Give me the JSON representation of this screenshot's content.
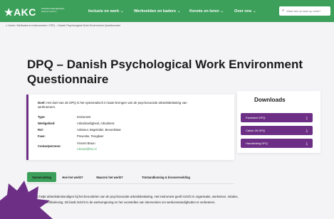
{
  "header": {
    "logo": "AKC",
    "logo_sub": "Arbeidsomstandigheden Kennis Centrum",
    "nav": [
      {
        "label": "Inclusie en werk"
      },
      {
        "label": "Werkvelden en kaders"
      },
      {
        "label": "Kennis en leren"
      },
      {
        "label": "Over ons"
      }
    ],
    "search_placeholder": "Waar ben je naar op zoek?"
  },
  "breadcrumb": {
    "home": "Home",
    "rest": "/ Methodes en instrumenten / DPQ – Danish Psychological Work Environment Questionnaire"
  },
  "page": {
    "title": "DPQ – Danish Psychological Work Environment Questionnaire"
  },
  "info": {
    "goal_label": "Doel:",
    "goal_text": "Het doel van de DPQ is het systematisch in kaart brengen van de psychosociale arbeidsbelasting van werknemers.",
    "rows": [
      {
        "key": "Type:",
        "value": "Instrument"
      },
      {
        "key": "Werkgebied:",
        "value": "Arbeidsveiligheid, Arbodienst"
      },
      {
        "key": "Rol:",
        "value": "Adviseur, Begeleider, Beoordelaar"
      },
      {
        "key": "Fase:",
        "value": "Preventie, Terugkeer"
      },
      {
        "key": "Contactpersoon:",
        "value": "Vincent Braun",
        "value2": "v.braun@tno.nl"
      }
    ]
  },
  "downloads": {
    "title": "Downloads",
    "items": [
      {
        "label": "Factsheet DPQ"
      },
      {
        "label": "Cahier 26 DPQ"
      },
      {
        "label": "Handleiding DPQ"
      }
    ]
  },
  "tabs": [
    {
      "label": "Samenvatting"
    },
    {
      "label": "Hoe het werkt?"
    },
    {
      "label": "Waarom het werkt?"
    },
    {
      "label": "Totstandkoming & bronvermelding"
    }
  ],
  "summary": {
    "text": "De DPQ helpt arbeidsdeskundigen bij het beoordelen van de psychosociale arbeidsbelasting. Het instrument geeft inzicht in organisatie, werkeisen, relaties, conflicten en werkbeleving. Dit biedt inzicht in de werkomgeving en het voorstellen van interventies om werkomstandigheden te verbeteren."
  },
  "colors": {
    "brand_green": "#3ca05a",
    "accent_purple": "#6d2f86",
    "background": "#f4f4f6"
  },
  "icons": {
    "search": "search-icon",
    "download": "download-icon",
    "home": "home-icon",
    "chevron": "chevron-down-icon"
  }
}
